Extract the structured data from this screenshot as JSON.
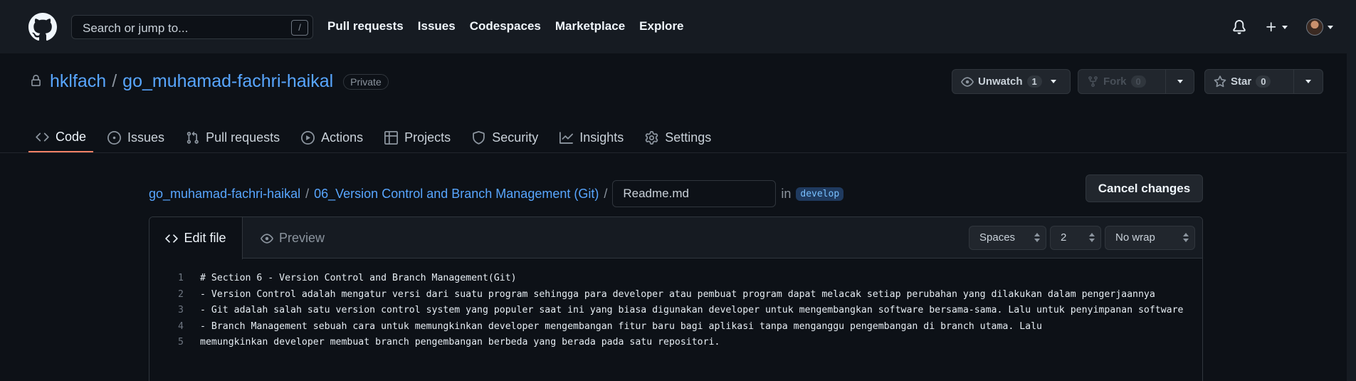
{
  "header": {
    "search_placeholder": "Search or jump to...",
    "search_shortcut": "/",
    "nav": [
      "Pull requests",
      "Issues",
      "Codespaces",
      "Marketplace",
      "Explore"
    ]
  },
  "repo": {
    "owner": "hklfach",
    "separator": "/",
    "name": "go_muhamad-fachri-haikal",
    "visibility": "Private",
    "unwatch_label": "Unwatch",
    "watch_count": "1",
    "fork_label": "Fork",
    "fork_count": "0",
    "star_label": "Star",
    "star_count": "0"
  },
  "tabs": [
    {
      "label": "Code",
      "icon": "code-icon"
    },
    {
      "label": "Issues",
      "icon": "issue-icon"
    },
    {
      "label": "Pull requests",
      "icon": "pull-request-icon"
    },
    {
      "label": "Actions",
      "icon": "play-icon"
    },
    {
      "label": "Projects",
      "icon": "table-icon"
    },
    {
      "label": "Security",
      "icon": "shield-icon"
    },
    {
      "label": "Insights",
      "icon": "graph-icon"
    },
    {
      "label": "Settings",
      "icon": "gear-icon"
    }
  ],
  "breadcrumb": {
    "root": "go_muhamad-fachri-haikal",
    "folder": "06_Version Control and Branch Management (Git)",
    "sep": "/",
    "filename": "Readme.md",
    "in_label": "in",
    "branch": "develop"
  },
  "cancel_label": "Cancel changes",
  "editor": {
    "edit_tab": "Edit file",
    "preview_tab": "Preview",
    "indent_mode": "Spaces",
    "indent_size": "2",
    "wrap_mode": "No wrap",
    "lines": [
      {
        "n": "1",
        "text": "# Section 6 - Version Control and Branch Management(Git)"
      },
      {
        "n": "2",
        "text": "- Version Control adalah mengatur versi dari suatu program sehingga para developer atau pembuat program dapat melacak setiap perubahan yang dilakukan dalam pengerjaannya"
      },
      {
        "n": "3",
        "text": "- Git adalah salah satu version control system yang populer saat ini yang biasa digunakan developer untuk mengembangkan software bersama-sama. Lalu untuk penyimpanan software"
      },
      {
        "n": "4",
        "text": "- Branch Management sebuah cara untuk memungkinkan developer mengembangan fitur baru bagi aplikasi tanpa menganggu pengembangan di branch utama. Lalu"
      },
      {
        "n": "5",
        "text": "memungkinkan developer membuat branch pengembangan berbeda yang berada pada satu repositori."
      }
    ]
  }
}
